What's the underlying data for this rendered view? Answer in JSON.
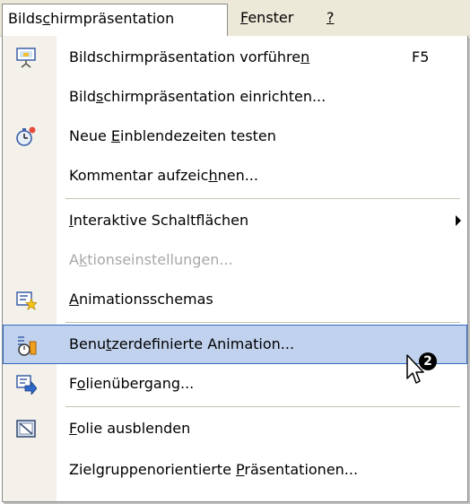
{
  "menubar": {
    "items": [
      {
        "pre": "Bilds",
        "key": "c",
        "post": "hirmpräsentation"
      },
      {
        "pre": "",
        "key": "F",
        "post": "enster"
      },
      {
        "pre": "",
        "key": "?",
        "post": ""
      }
    ]
  },
  "menu": {
    "items": [
      {
        "pre": "Bildschirmpräsentation vorführe",
        "key": "n",
        "post": "",
        "shortcut": "F5",
        "icon": "projector-screen-icon"
      },
      {
        "pre": "Bild",
        "key": "s",
        "post": "chirmpräsentation einrichten...",
        "icon": ""
      },
      {
        "pre": "Neue ",
        "key": "E",
        "post": "inblendezeiten testen",
        "icon": "stopwatch-icon"
      },
      {
        "pre": "Kommentar aufzeic",
        "key": "h",
        "post": "nen...",
        "icon": ""
      },
      {
        "pre": "",
        "key": "I",
        "post": "nteraktive Schaltflächen",
        "icon": "",
        "submenu": true
      },
      {
        "pre": "A",
        "key": "k",
        "post": "tionseinstellungen...",
        "icon": "",
        "disabled": true
      },
      {
        "pre": "",
        "key": "A",
        "post": "nimationsschemas",
        "icon": "animation-schemes-icon"
      },
      {
        "pre": "Benu",
        "key": "t",
        "post": "zerdefinierte Animation...",
        "icon": "custom-animation-icon",
        "selected": true
      },
      {
        "pre": "F",
        "key": "o",
        "post": "lienübergang...",
        "icon": "slide-transition-icon"
      },
      {
        "pre": "",
        "key": "F",
        "post": "olie ausblenden",
        "icon": "hide-slide-icon"
      },
      {
        "pre": "Zielgruppenorientierte ",
        "key": "P",
        "post": "räsentationen...",
        "icon": ""
      }
    ]
  },
  "annotation": {
    "badge": "2"
  },
  "colors": {
    "highlight": "#c1d2ee",
    "highlight_border": "#316ac5",
    "menubar": "#ece9d8"
  }
}
